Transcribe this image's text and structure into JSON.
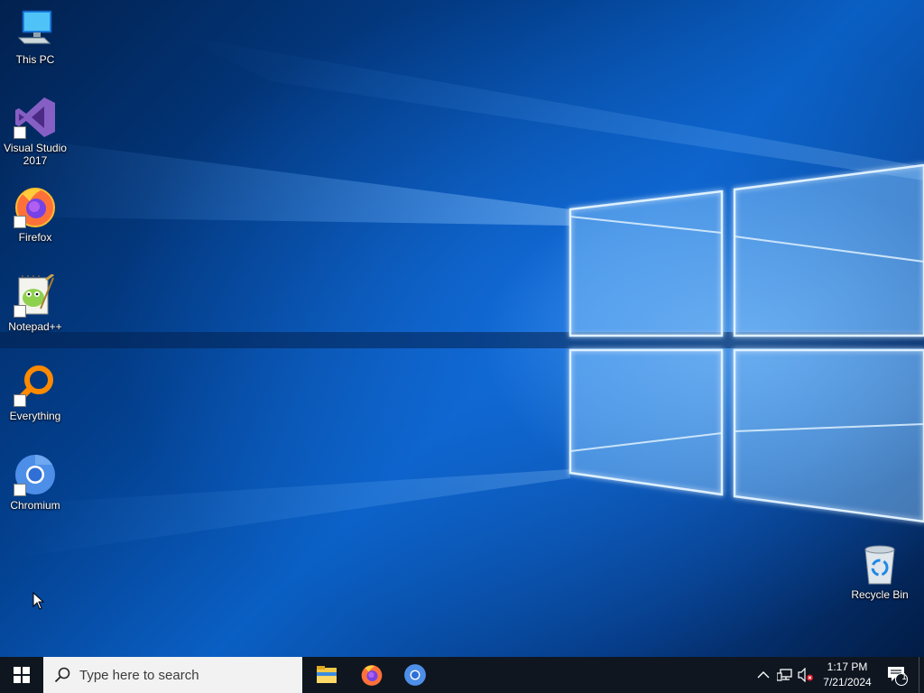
{
  "desktop": {
    "icons": [
      {
        "label_line1": "This PC",
        "label_line2": "",
        "icon": "this-pc-icon"
      },
      {
        "label_line1": "Visual Studio",
        "label_line2": "2017",
        "icon": "visual-studio-icon"
      },
      {
        "label_line1": "Firefox",
        "label_line2": "",
        "icon": "firefox-icon"
      },
      {
        "label_line1": "Notepad++",
        "label_line2": "",
        "icon": "notepad-plus-plus-icon"
      },
      {
        "label_line1": "Everything",
        "label_line2": "",
        "icon": "everything-icon"
      },
      {
        "label_line1": "Chromium",
        "label_line2": "",
        "icon": "chromium-icon"
      }
    ],
    "recycle_bin": {
      "label": "Recycle Bin",
      "icon": "recycle-bin-icon"
    }
  },
  "taskbar": {
    "start_icon": "windows-logo-icon",
    "search": {
      "placeholder": "Type here to search",
      "icon": "search-icon"
    },
    "pinned_apps": [
      {
        "name": "File Explorer",
        "icon": "file-explorer-icon"
      },
      {
        "name": "Firefox",
        "icon": "firefox-icon"
      },
      {
        "name": "Chromium",
        "icon": "chromium-icon"
      }
    ],
    "tray": {
      "icons": [
        "chevron-up-icon",
        "network-icon",
        "volume-muted-icon"
      ],
      "time": "1:17 PM",
      "date": "7/21/2024",
      "notifications_count": "1"
    }
  },
  "colors": {
    "taskbar_bg": "#0f1620",
    "search_bg": "#f2f2f2",
    "wallpaper_blue": "#0a5fc4"
  }
}
